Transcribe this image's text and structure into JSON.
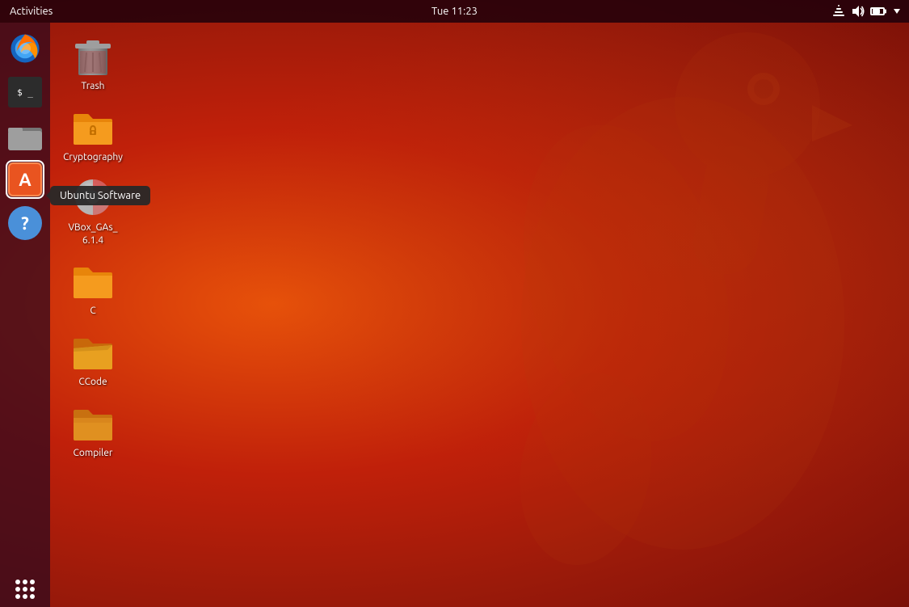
{
  "topbar": {
    "activities_label": "Activities",
    "clock": "Tue 11:23"
  },
  "sidebar": {
    "items": [
      {
        "id": "firefox",
        "label": "Firefox",
        "active": false
      },
      {
        "id": "terminal",
        "label": "Terminal",
        "active": false
      },
      {
        "id": "files",
        "label": "Files",
        "active": false
      },
      {
        "id": "ubuntu-software",
        "label": "Ubuntu Software",
        "active": true
      },
      {
        "id": "help",
        "label": "Help",
        "active": false
      }
    ],
    "apps_grid_label": "Show Applications"
  },
  "tooltip": {
    "text": "Ubuntu Software"
  },
  "desktop_icons": [
    {
      "id": "trash",
      "label": "Trash",
      "type": "trash"
    },
    {
      "id": "cryptography",
      "label": "Cryptography",
      "type": "folder-orange"
    },
    {
      "id": "vbox-gas",
      "label": "VBox_GAs_\n6.1.4",
      "type": "cd"
    },
    {
      "id": "c-folder",
      "label": "C",
      "type": "folder-orange"
    },
    {
      "id": "ccode",
      "label": "CCode",
      "type": "folder-orange-open"
    },
    {
      "id": "compiler",
      "label": "Compiler",
      "type": "folder-orange-half"
    }
  ]
}
